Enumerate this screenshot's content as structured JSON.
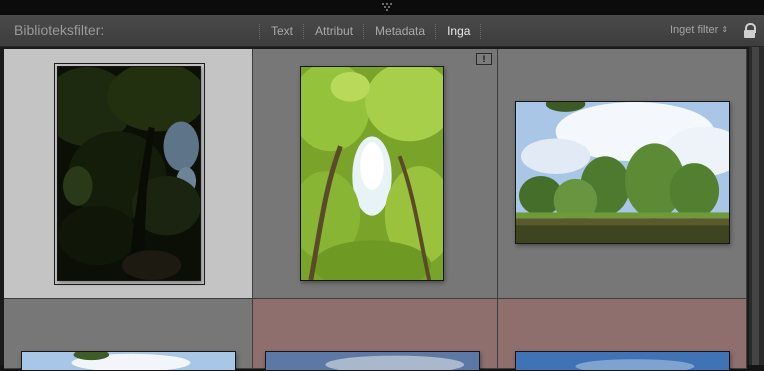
{
  "filter_bar": {
    "title": "Biblioteksfilter:",
    "tabs": [
      {
        "label": "Text",
        "active": false
      },
      {
        "label": "Attribut",
        "active": false
      },
      {
        "label": "Metadata",
        "active": false
      },
      {
        "label": "Inga",
        "active": true
      }
    ],
    "preset": "Inget filter",
    "preset_arrow": "⇕",
    "lock_icon": "lock-icon"
  },
  "grid": {
    "badge_text": "!",
    "cell_colors": {
      "selected": "#c4c4c4",
      "normal": "#777777",
      "red_label": "#8f6e6e"
    },
    "cells": [
      {
        "subject": "dark tree canopy",
        "selected": true,
        "label": "none"
      },
      {
        "subject": "green tree canopy looking up",
        "selected": false,
        "label": "none",
        "badge": "!"
      },
      {
        "subject": "park with trees and pond",
        "selected": false,
        "label": "none"
      },
      {
        "subject": "sky and leaves",
        "selected": false,
        "label": "none"
      },
      {
        "subject": "blue sky with clouds",
        "selected": false,
        "label": "red"
      },
      {
        "subject": "blue sky",
        "selected": false,
        "label": "red"
      }
    ]
  }
}
